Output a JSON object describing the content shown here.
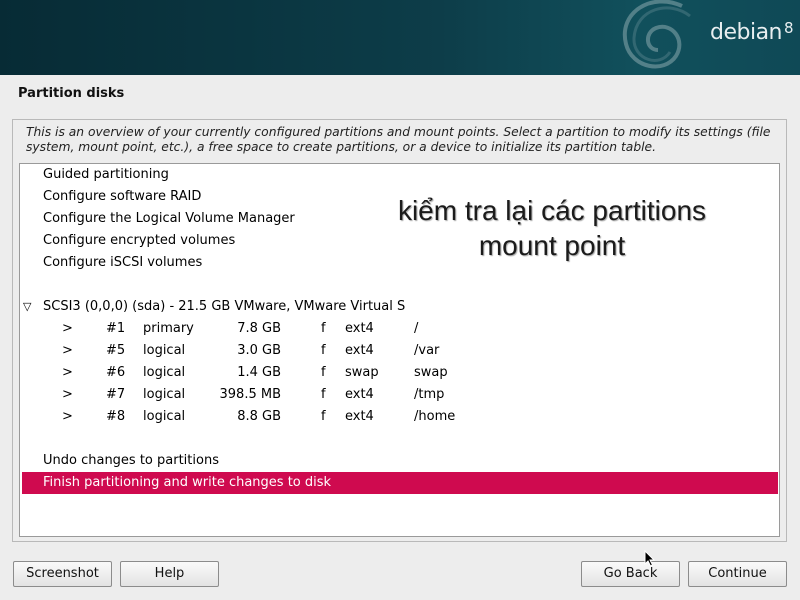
{
  "banner": {
    "brand": "debian",
    "version": "8"
  },
  "step_title": "Partition disks",
  "intro": "This is an overview of your currently configured partitions and mount points. Select a partition to modify its settings (file system, mount point, etc.), a free space to create partitions, or a device to initialize its partition table.",
  "menu": [
    "Guided partitioning",
    "Configure software RAID",
    "Configure the Logical Volume Manager",
    "Configure encrypted volumes",
    "Configure iSCSI volumes"
  ],
  "disk": {
    "toggle": "▽",
    "label": "SCSI3 (0,0,0) (sda) - 21.5 GB VMware, VMware Virtual S",
    "partitions": [
      {
        "arrow": ">",
        "num": "#1",
        "type": "primary",
        "size": "7.8 GB",
        "flag": "f",
        "fs": "ext4",
        "mount": "/"
      },
      {
        "arrow": ">",
        "num": "#5",
        "type": "logical",
        "size": "3.0 GB",
        "flag": "f",
        "fs": "ext4",
        "mount": "/var"
      },
      {
        "arrow": ">",
        "num": "#6",
        "type": "logical",
        "size": "1.4 GB",
        "flag": "f",
        "fs": "swap",
        "mount": "swap"
      },
      {
        "arrow": ">",
        "num": "#7",
        "type": "logical",
        "size": "398.5 MB",
        "flag": "f",
        "fs": "ext4",
        "mount": "/tmp"
      },
      {
        "arrow": ">",
        "num": "#8",
        "type": "logical",
        "size": "8.8 GB",
        "flag": "f",
        "fs": "ext4",
        "mount": "/home"
      }
    ]
  },
  "undo": "Undo changes to partitions",
  "finish": "Finish partitioning and write changes to disk",
  "annotation": {
    "line1": "kiểm tra lại các partitions",
    "line2": "mount point"
  },
  "buttons": {
    "screenshot": "Screenshot",
    "help": "Help",
    "back": "Go Back",
    "continue": "Continue"
  },
  "colors": {
    "selected": "#cf0a4f",
    "banner": "#0d3d49"
  }
}
